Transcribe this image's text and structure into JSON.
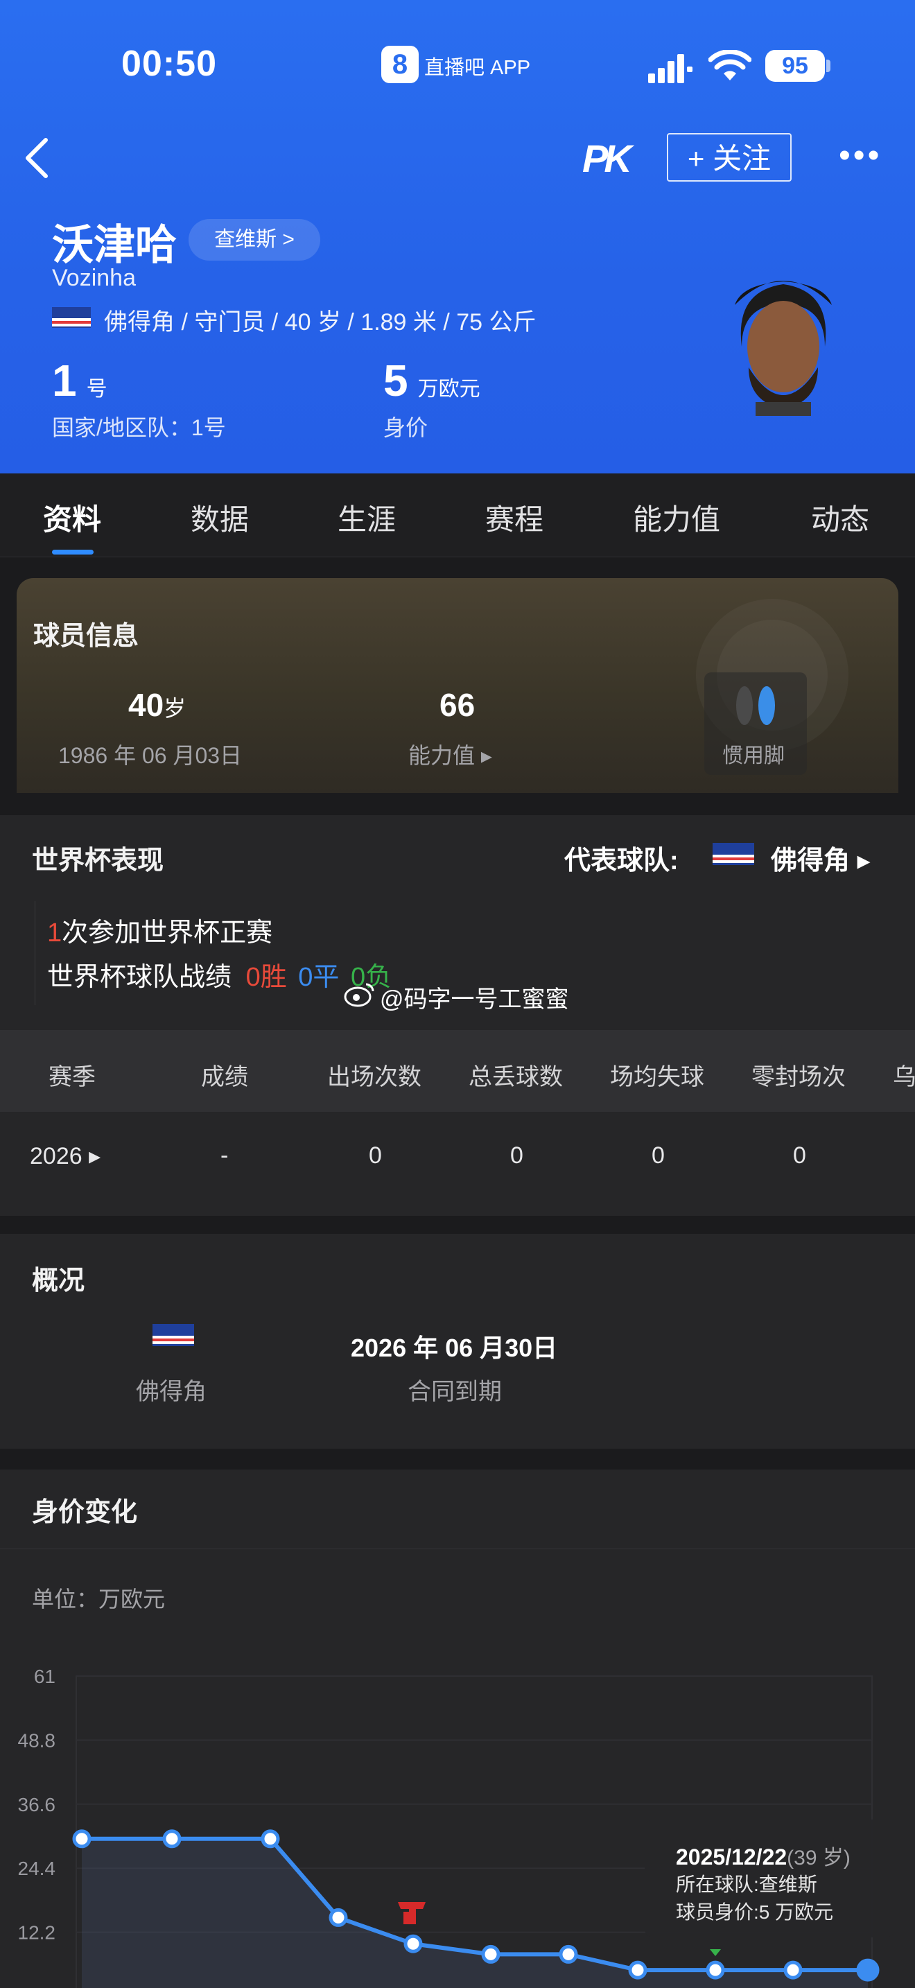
{
  "status_bar": {
    "time": "00:50",
    "app_badge": "8",
    "app_name": "直播吧 APP",
    "battery": "95"
  },
  "nav": {
    "pk_label": "PK",
    "follow_label": "+ 关注",
    "more_label": "•••"
  },
  "player": {
    "name_cn": "沃津哈",
    "team_link": "查维斯 >",
    "name_en": "Vozinha",
    "meta": "佛得角 / 守门员 / 40 岁 / 1.89 米 / 75 公斤",
    "number": "1",
    "number_unit": "号",
    "national_number": "国家/地区队：1号",
    "value": "5",
    "value_unit": "万欧元",
    "value_label": "身价"
  },
  "tabs": [
    "资料",
    "数据",
    "生涯",
    "赛程",
    "能力值",
    "动态"
  ],
  "info_card": {
    "title": "球员信息",
    "age": "40",
    "age_unit": "岁",
    "birthday": "1986 年 06 月03日",
    "rating": "66",
    "rating_label": "能力值 ▸",
    "foot_label": "惯用脚"
  },
  "world_cup": {
    "title": "世界杯表现",
    "rep_label": "代表球队:",
    "rep_team": "佛得角 ▸",
    "apps_count": "1",
    "apps_text": "次参加世界杯正赛",
    "record_label": "世界杯球队战绩",
    "wins": "0胜",
    "draws": "0平",
    "losses": "0负",
    "watermark": "@码字一号工蜜蜜",
    "columns": [
      "赛季",
      "成绩",
      "出场次数",
      "总丢球数",
      "场均失球",
      "零封场次",
      "乌"
    ],
    "rows": [
      [
        "2026 ▸",
        "-",
        "0",
        "0",
        "0",
        "0"
      ]
    ]
  },
  "overview": {
    "title": "概况",
    "country": "佛得角",
    "contract_date": "2026 年 06 月30日",
    "contract_label": "合同到期"
  },
  "market_value": {
    "title": "身价变化",
    "unit_label": "单位：万欧元",
    "tooltip_date": "2025/12/22",
    "tooltip_age": "(39 岁)",
    "tooltip_club": "所在球队:查维斯",
    "tooltip_value": "球员身价:5 万欧元"
  },
  "chart_data": {
    "type": "area",
    "title": "身价变化",
    "ylabel": "单位：万欧元",
    "y_ticks": [
      "61",
      "48.8",
      "36.6",
      "24.4",
      "12.2"
    ],
    "ylim": [
      0,
      61
    ],
    "series": [
      {
        "values": [
          30,
          30,
          30,
          15,
          10,
          8,
          8,
          5,
          5,
          5,
          5
        ]
      }
    ],
    "line_color": "#3b8cf0"
  }
}
